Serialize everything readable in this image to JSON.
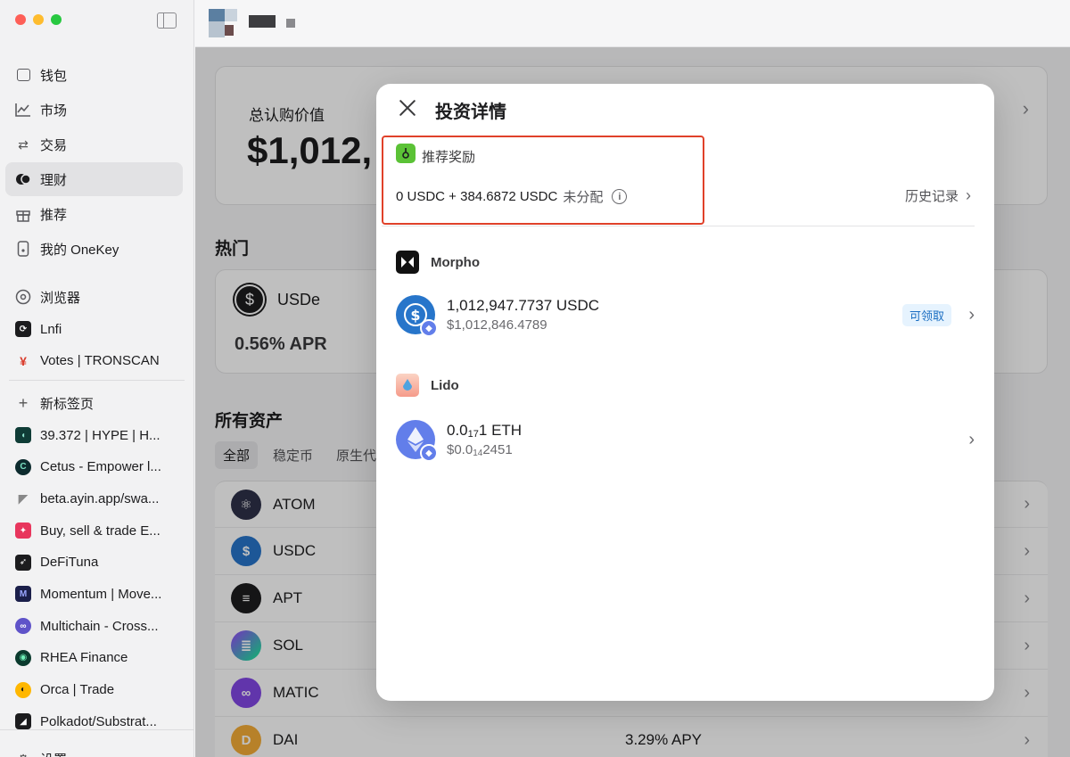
{
  "sidebar": {
    "main_items": [
      {
        "label": "钱包",
        "icon": "wallet-icon"
      },
      {
        "label": "市场",
        "icon": "chart-icon"
      },
      {
        "label": "交易",
        "icon": "swap-icon"
      },
      {
        "label": "理财",
        "icon": "earn-icon"
      },
      {
        "label": "推荐",
        "icon": "gift-icon"
      },
      {
        "label": "我的 OneKey",
        "icon": "device-icon"
      }
    ],
    "dapp_items": [
      {
        "label": "浏览器",
        "icon": "compass-icon"
      },
      {
        "label": "Lnfi",
        "icon": "lnfi-icon"
      },
      {
        "label": "Votes | TRONSCAN",
        "icon": "tronscan-icon"
      }
    ],
    "new_tab_label": "新标签页",
    "tabs": [
      {
        "label": "39.372 | HYPE | H...",
        "color": "#0f3c36"
      },
      {
        "label": "Cetus - Empower l...",
        "color": "#0d2b2e"
      },
      {
        "label": "beta.ayin.app/swa...",
        "color": "#ffffff"
      },
      {
        "label": "Buy, sell & trade E...",
        "color": "#e8365d"
      },
      {
        "label": "DeFiTuna",
        "color": "#1c1c1e"
      },
      {
        "label": "Momentum | Move...",
        "color": "#1b1f4a"
      },
      {
        "label": "Multichain - Cross...",
        "color": "#5f53c9"
      },
      {
        "label": "RHEA Finance",
        "color": "#0b3b2e"
      },
      {
        "label": "Orca | Trade",
        "color": "#ffb700"
      },
      {
        "label": "Polkadot/Substrat...",
        "color": "#1c1c1e"
      }
    ],
    "settings_label": "设置"
  },
  "background": {
    "total_label": "总认购价值",
    "total_value": "$1,012,",
    "hot_heading": "热门",
    "hot_token": "USDe",
    "hot_apr": "0.56% APR",
    "assets_heading": "所有资产",
    "filters": [
      "全部",
      "稳定币",
      "原生代币"
    ],
    "assets": [
      {
        "name": "ATOM",
        "apy": "",
        "color": "#2e3148"
      },
      {
        "name": "USDC",
        "apy": "",
        "color": "#2775ca"
      },
      {
        "name": "APT",
        "apy": "",
        "color": "#1c1c1e"
      },
      {
        "name": "SOL",
        "apy": "",
        "color": "#9945ff"
      },
      {
        "name": "MATIC",
        "apy": "",
        "color": "#8247e5"
      },
      {
        "name": "DAI",
        "apy": "3.29% APY",
        "color": "#f5ac37"
      }
    ]
  },
  "modal": {
    "title": "投资详情",
    "referral": {
      "label": "推荐奖励",
      "amount": "0 USDC + 384.6872 USDC",
      "status": "未分配",
      "history_label": "历史记录"
    },
    "positions": [
      {
        "protocol": "Morpho",
        "amount": "1,012,947.7737 USDC",
        "value": "$1,012,846.4789",
        "badge": "可领取",
        "token_icon": "usdc-icon"
      },
      {
        "protocol": "Lido",
        "amount_prefix": "0.0",
        "amount_sub": "17",
        "amount_suffix": "1 ETH",
        "value_prefix": "$0.0",
        "value_sub": "14",
        "value_suffix": "2451",
        "token_icon": "eth-icon"
      }
    ]
  },
  "colors": {
    "highlight_border": "#e0412a",
    "accent_green": "#5bc236",
    "usdc_blue": "#2775ca",
    "eth_purple": "#627eea"
  }
}
